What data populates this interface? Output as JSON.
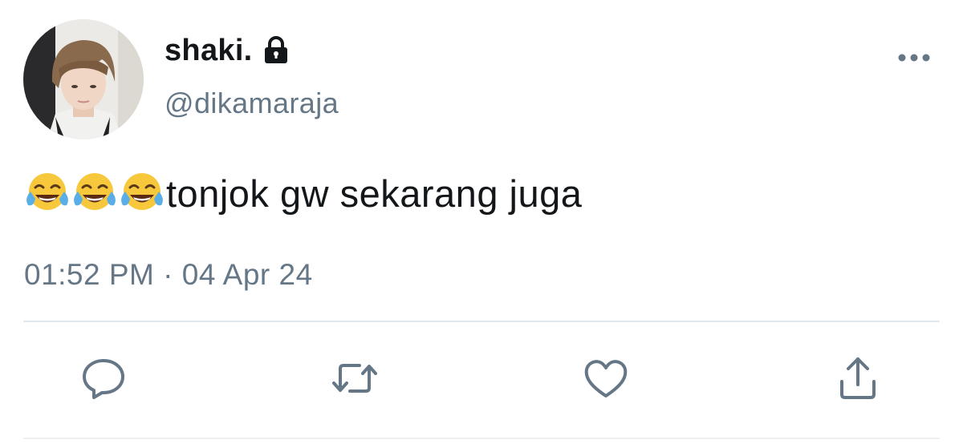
{
  "user": {
    "display_name": "shaki.",
    "handle": "@dikamaraja",
    "protected": true,
    "avatar_icon": "profile-photo"
  },
  "tweet": {
    "emoji": [
      "😂",
      "😂",
      "😂"
    ],
    "text": "tonjok gw sekarang juga",
    "timestamp": "01:52 PM · 04 Apr 24"
  },
  "actions": [
    {
      "icon": "reply-icon"
    },
    {
      "icon": "retweet-icon"
    },
    {
      "icon": "like-icon"
    },
    {
      "icon": "share-icon"
    }
  ],
  "menu": {
    "icon": "more-options-icon"
  },
  "colors": {
    "text_primary": "#14171a",
    "text_secondary": "#657786",
    "icon": "#657786",
    "divider": "#e1e8ed"
  }
}
